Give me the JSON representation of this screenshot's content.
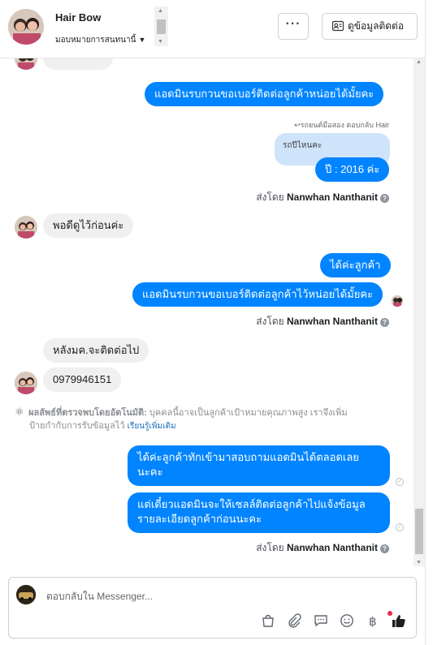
{
  "header": {
    "name": "Hair Bow",
    "assign_label": "มอบหมายการสนทนานี้",
    "more_label": "···",
    "contact_label": "ดูข้อมูลติดต่อ"
  },
  "messages": {
    "out_1": "แอดมินรบกวนขอเบอร์ติดต่อลูกค้าหน่อยได้มั้ยคะ",
    "reply_note": "รถยนต์มือสอง ตอบกลับ Hair",
    "quoted": "รถปีไหนคะ",
    "out_2": "ปี : 2016 ค่ะ",
    "in_1": "พอดีดูไว้ก่อนค่ะ",
    "out_3": "ได้ค่ะลูกค้า",
    "out_4": "แอดมินรบกวนขอเบอร์ติดต่อลูกค้าไว้หน่อยได้มั้ยคะ",
    "in_2": "หลังมค.จะติดต่อไป",
    "in_3": "0979946151",
    "out_5_line1": "ได้ค่ะลูกค้าทักเข้ามาสอบถามแอดมินได้ตลอดเลย",
    "out_5_line2": "นะคะ",
    "out_6_line1": "แต่เดี๋ยวแอดมินจะให้เซลล์ติดต่อลูกค้าไปแจ้งข้อมูล",
    "out_6_line2": "รายละเอียดลูกค้าก่อนนะคะ"
  },
  "sent_by": {
    "prefix": "ส่งโดย",
    "name": "Nanwhan Nanthanit"
  },
  "auto_detect": {
    "title": "ผลลัพธ์ที่ตรวจพบโดยอัตโนมัติ:",
    "body_line1": "บุคคลนี้อาจเป็นลูกค้าเป้าหมายคุณภาพสูง เราจึงเพิ่ม",
    "body_line2": "ป้ายกำกับการรับข้อมูลไว้",
    "learn_more": "เรียนรู้เพิ่มเติม"
  },
  "composer": {
    "placeholder": "ตอบกลับใน Messenger..."
  },
  "colors": {
    "outgoing_bubble": "#0084ff",
    "incoming_bubble": "#f0f0f0",
    "quoted_bubble": "#cfe3fb",
    "like_icon": "#1c1e21",
    "notification_dot": "#f02849"
  }
}
